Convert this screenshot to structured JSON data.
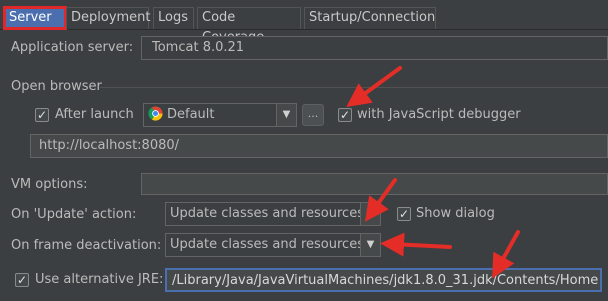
{
  "tabs": [
    {
      "label": "Server",
      "active": true
    },
    {
      "label": "Deployment"
    },
    {
      "label": "Logs"
    },
    {
      "label": "Code Coverage"
    },
    {
      "label": "Startup/Connection"
    }
  ],
  "application_server": {
    "label": "Application server:",
    "value": "Tomcat 8.0.21"
  },
  "open_browser": {
    "section_label": "Open browser",
    "after_launch_label": "After launch",
    "after_launch_checked": true,
    "browser_value": "Default",
    "browse_button": "...",
    "js_debugger_label": "with JavaScript debugger",
    "js_debugger_checked": true,
    "url": "http://localhost:8080/"
  },
  "vm_options": {
    "label": "VM options:",
    "value": ""
  },
  "on_update": {
    "label": "On 'Update' action:",
    "value": "Update classes and resources",
    "show_dialog_label": "Show dialog",
    "show_dialog_checked": true
  },
  "on_frame_deactivation": {
    "label": "On frame deactivation:",
    "value": "Update classes and resources"
  },
  "alt_jre": {
    "label": "Use alternative JRE:",
    "checked": true,
    "path": "/Library/Java/JavaVirtualMachines/jdk1.8.0_31.jdk/Contents/Home"
  },
  "colors": {
    "background": "#3c3f41",
    "active_tab": "#4b6eaf",
    "highlight": "#e0282b",
    "annotation_arrow": "#e52d27"
  },
  "icons": {
    "browser": "chrome-icon",
    "dropdown": "chevron-down-icon",
    "check": "checkmark-icon"
  }
}
